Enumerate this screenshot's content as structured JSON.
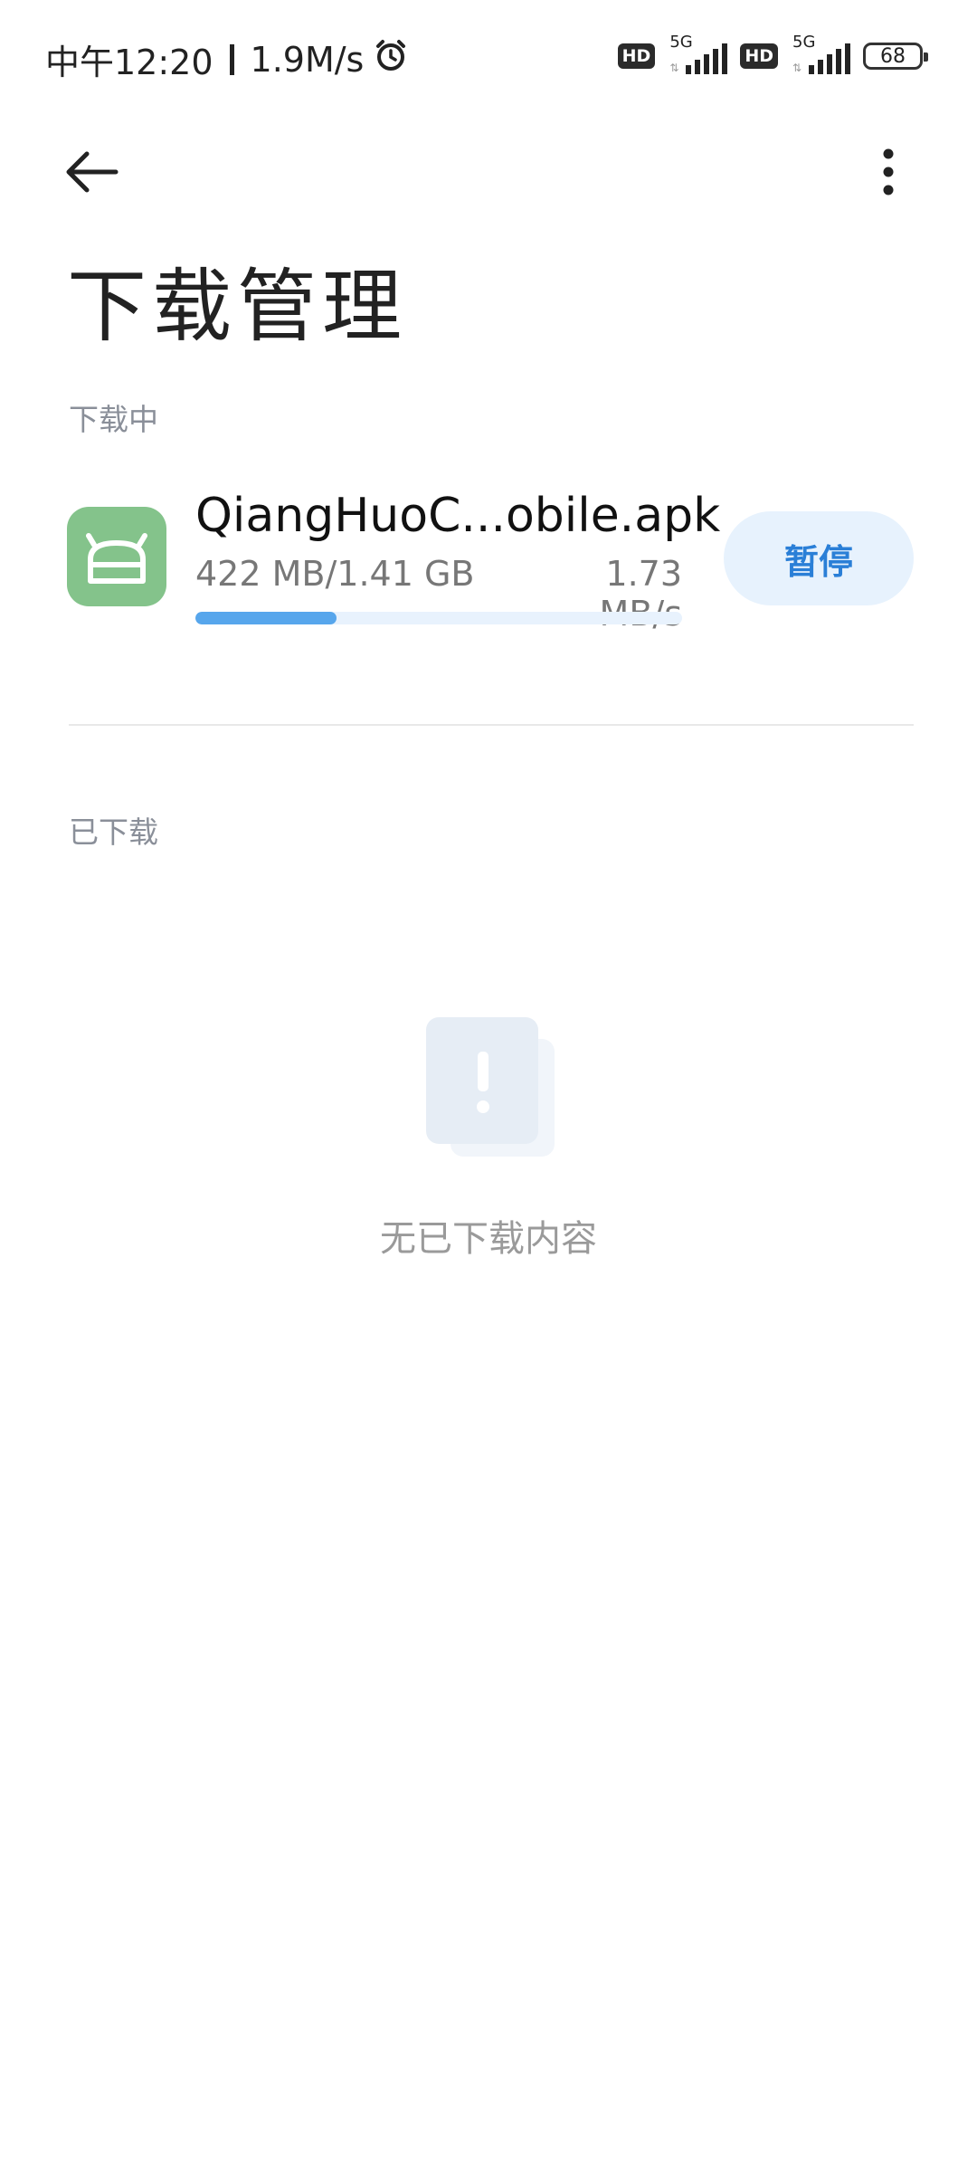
{
  "status_bar": {
    "time": "中午12:20",
    "network_speed": "1.9M/s",
    "sim1": {
      "hd": "HD",
      "type": "5G"
    },
    "sim2": {
      "hd": "HD",
      "type": "5G"
    },
    "battery": "68"
  },
  "header": {
    "title": "下载管理",
    "back_icon": "arrow-left-icon",
    "more_icon": "more-vertical-icon"
  },
  "downloading": {
    "label": "下载中",
    "item": {
      "icon": "android-icon",
      "icon_color": "#84c38b",
      "file_name": "QiangHuoC...obile.apk",
      "progress": "422 MB/1.41 GB",
      "speed": "1.73 MB/s",
      "progress_fraction": 0.29,
      "action_label": "暂停"
    }
  },
  "downloaded": {
    "label": "已下载",
    "empty_icon": "exclamation-card-icon",
    "empty_text": "无已下载内容"
  },
  "colors": {
    "accent": "#2a7fd7",
    "progress": "#57a6ec"
  }
}
